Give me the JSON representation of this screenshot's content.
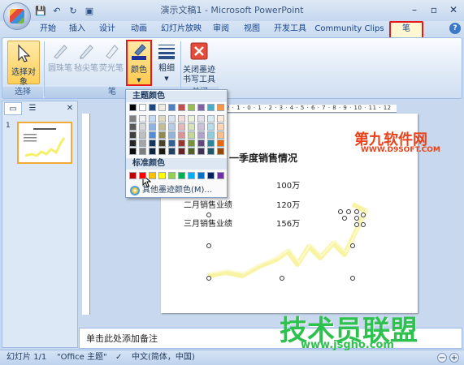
{
  "window": {
    "title": "演示文稿1 - Microsoft PowerPoint",
    "minimize": "–",
    "restore": "▫",
    "close": "✕"
  },
  "qat": [
    "💾",
    "↶",
    "↻",
    "▣"
  ],
  "tabs": [
    "开始",
    "插入",
    "设计",
    "动画",
    "幻灯片放映",
    "审阅",
    "视图",
    "开发工具",
    "Community Clips",
    "笔"
  ],
  "ribbon": {
    "select_object": "选择对象",
    "ballpoint_pen": "圆珠笔",
    "felt_pen": "毡尖笔",
    "highlighter": "荧光笔",
    "color": "颜色",
    "thickness": "粗细",
    "close_ink_line1": "关闭墨迹",
    "close_ink_line2": "书写工具",
    "group_select": "选择",
    "group_pen": "笔",
    "group_close": "关闭"
  },
  "color_menu": {
    "theme_colors_header": "主题颜色",
    "standard_colors_header": "标准颜色",
    "more_colors": "其他墨迹颜色(M)...",
    "theme_top_row": [
      "#000000",
      "#ffffff",
      "#1f497d",
      "#eeece1",
      "#4f81bd",
      "#c0504d",
      "#9bbb59",
      "#8064a2",
      "#4bacc6",
      "#f79646"
    ],
    "theme_shades": [
      [
        "#7f7f7f",
        "#f2f2f2",
        "#c6d9f0",
        "#ddd9c3",
        "#dbe5f1",
        "#f2dcdb",
        "#ebf1dd",
        "#e5e0ec",
        "#dbeef3",
        "#fdeada"
      ],
      [
        "#595959",
        "#d8d8d8",
        "#8db3e2",
        "#c4bd97",
        "#b8cce4",
        "#e5b9b7",
        "#d7e3bc",
        "#ccc1d9",
        "#b7dde8",
        "#fbd5b5"
      ],
      [
        "#3f3f3f",
        "#bfbfbf",
        "#548dd4",
        "#938953",
        "#95b3d7",
        "#d99694",
        "#c3d69b",
        "#b2a2c7",
        "#92cddc",
        "#fac08f"
      ],
      [
        "#262626",
        "#a5a5a5",
        "#17365d",
        "#494429",
        "#366092",
        "#953734",
        "#76923c",
        "#5f497a",
        "#31859b",
        "#e36c09"
      ],
      [
        "#0c0c0c",
        "#7f7f7f",
        "#0f243e",
        "#1d1b10",
        "#244061",
        "#632423",
        "#4f6128",
        "#3f3151",
        "#205867",
        "#974806"
      ]
    ],
    "standard": [
      "#c00000",
      "#ff0000",
      "#ffc000",
      "#ffff00",
      "#92d050",
      "#00b050",
      "#00b0f0",
      "#0070c0",
      "#002060",
      "#7030a0"
    ]
  },
  "left_pane": {
    "tab_slides": "▭",
    "tab_outline": "☰",
    "close": "✕",
    "slide_number": "1"
  },
  "ruler": "2 · 1 · 0 · 1 · 2 · 3 · 4 · 5 · 6 · 7 · 8 · 9 · 10 · 11 · 12",
  "slide": {
    "title": "一季度销售情况",
    "rows": [
      {
        "label": "",
        "value": "100万"
      },
      {
        "label": "二月销售业绩",
        "value": "120万"
      },
      {
        "label": "三月销售业绩",
        "value": "156万"
      }
    ]
  },
  "notes_placeholder": "单击此处添加备注",
  "status": {
    "slide_info": "幻灯片 1/1",
    "theme": "\"Office 主题\"",
    "language": "中文(简体，中国)",
    "zoom_out": "−",
    "zoom_in": "+"
  },
  "watermarks": {
    "top_brand": "第九软件网",
    "top_url": "WWW.D9SOFT.COM",
    "bottom_brand": "技术员联盟",
    "bottom_url": "www.jsgho.com"
  }
}
